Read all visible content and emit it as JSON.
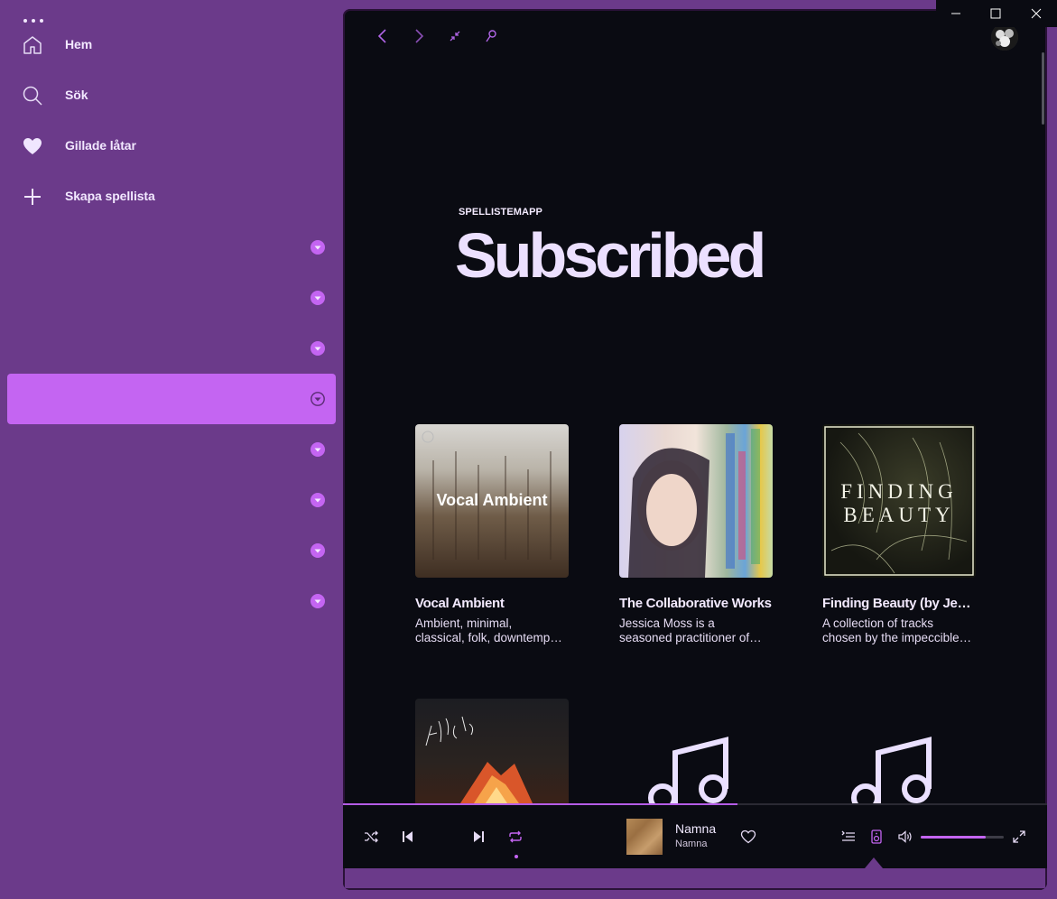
{
  "sidebar": {
    "nav": [
      {
        "label": "Hem",
        "icon": "home-icon"
      },
      {
        "label": "Sök",
        "icon": "search-icon"
      },
      {
        "label": "Gillade låtar",
        "icon": "heart-icon"
      },
      {
        "label": "Skapa spellista",
        "icon": "plus-icon"
      }
    ],
    "folders_count": 8,
    "active_folder_index": 3
  },
  "header": {
    "eyebrow": "SPELLISTEMAPP",
    "title": "Subscribed"
  },
  "cards": [
    {
      "title": "Vocal Ambient",
      "cover_text": "Vocal Ambient",
      "desc_line1": "Ambient, minimal,",
      "desc_line2": "classical, folk, downtempo…"
    },
    {
      "title": "The Collaborative Works",
      "cover_text": "",
      "desc_line1": "Jessica Moss is a",
      "desc_line2": "seasoned practitioner of…"
    },
    {
      "title": "Finding Beauty (by Je…",
      "cover_text": "FINDING BEAUTY",
      "cover_line1": "FINDING",
      "cover_line2": "BEAUTY",
      "desc_line1": "A collection of tracks",
      "desc_line2": "chosen by the impeccible…"
    }
  ],
  "now_playing": {
    "title": "Namna",
    "artist": "Namna",
    "progress": 0.56,
    "volume": 0.78
  },
  "colors": {
    "accent": "#c465f2",
    "sidebar_bg": "#6b3a8a",
    "main_bg": "#0a0b12"
  }
}
